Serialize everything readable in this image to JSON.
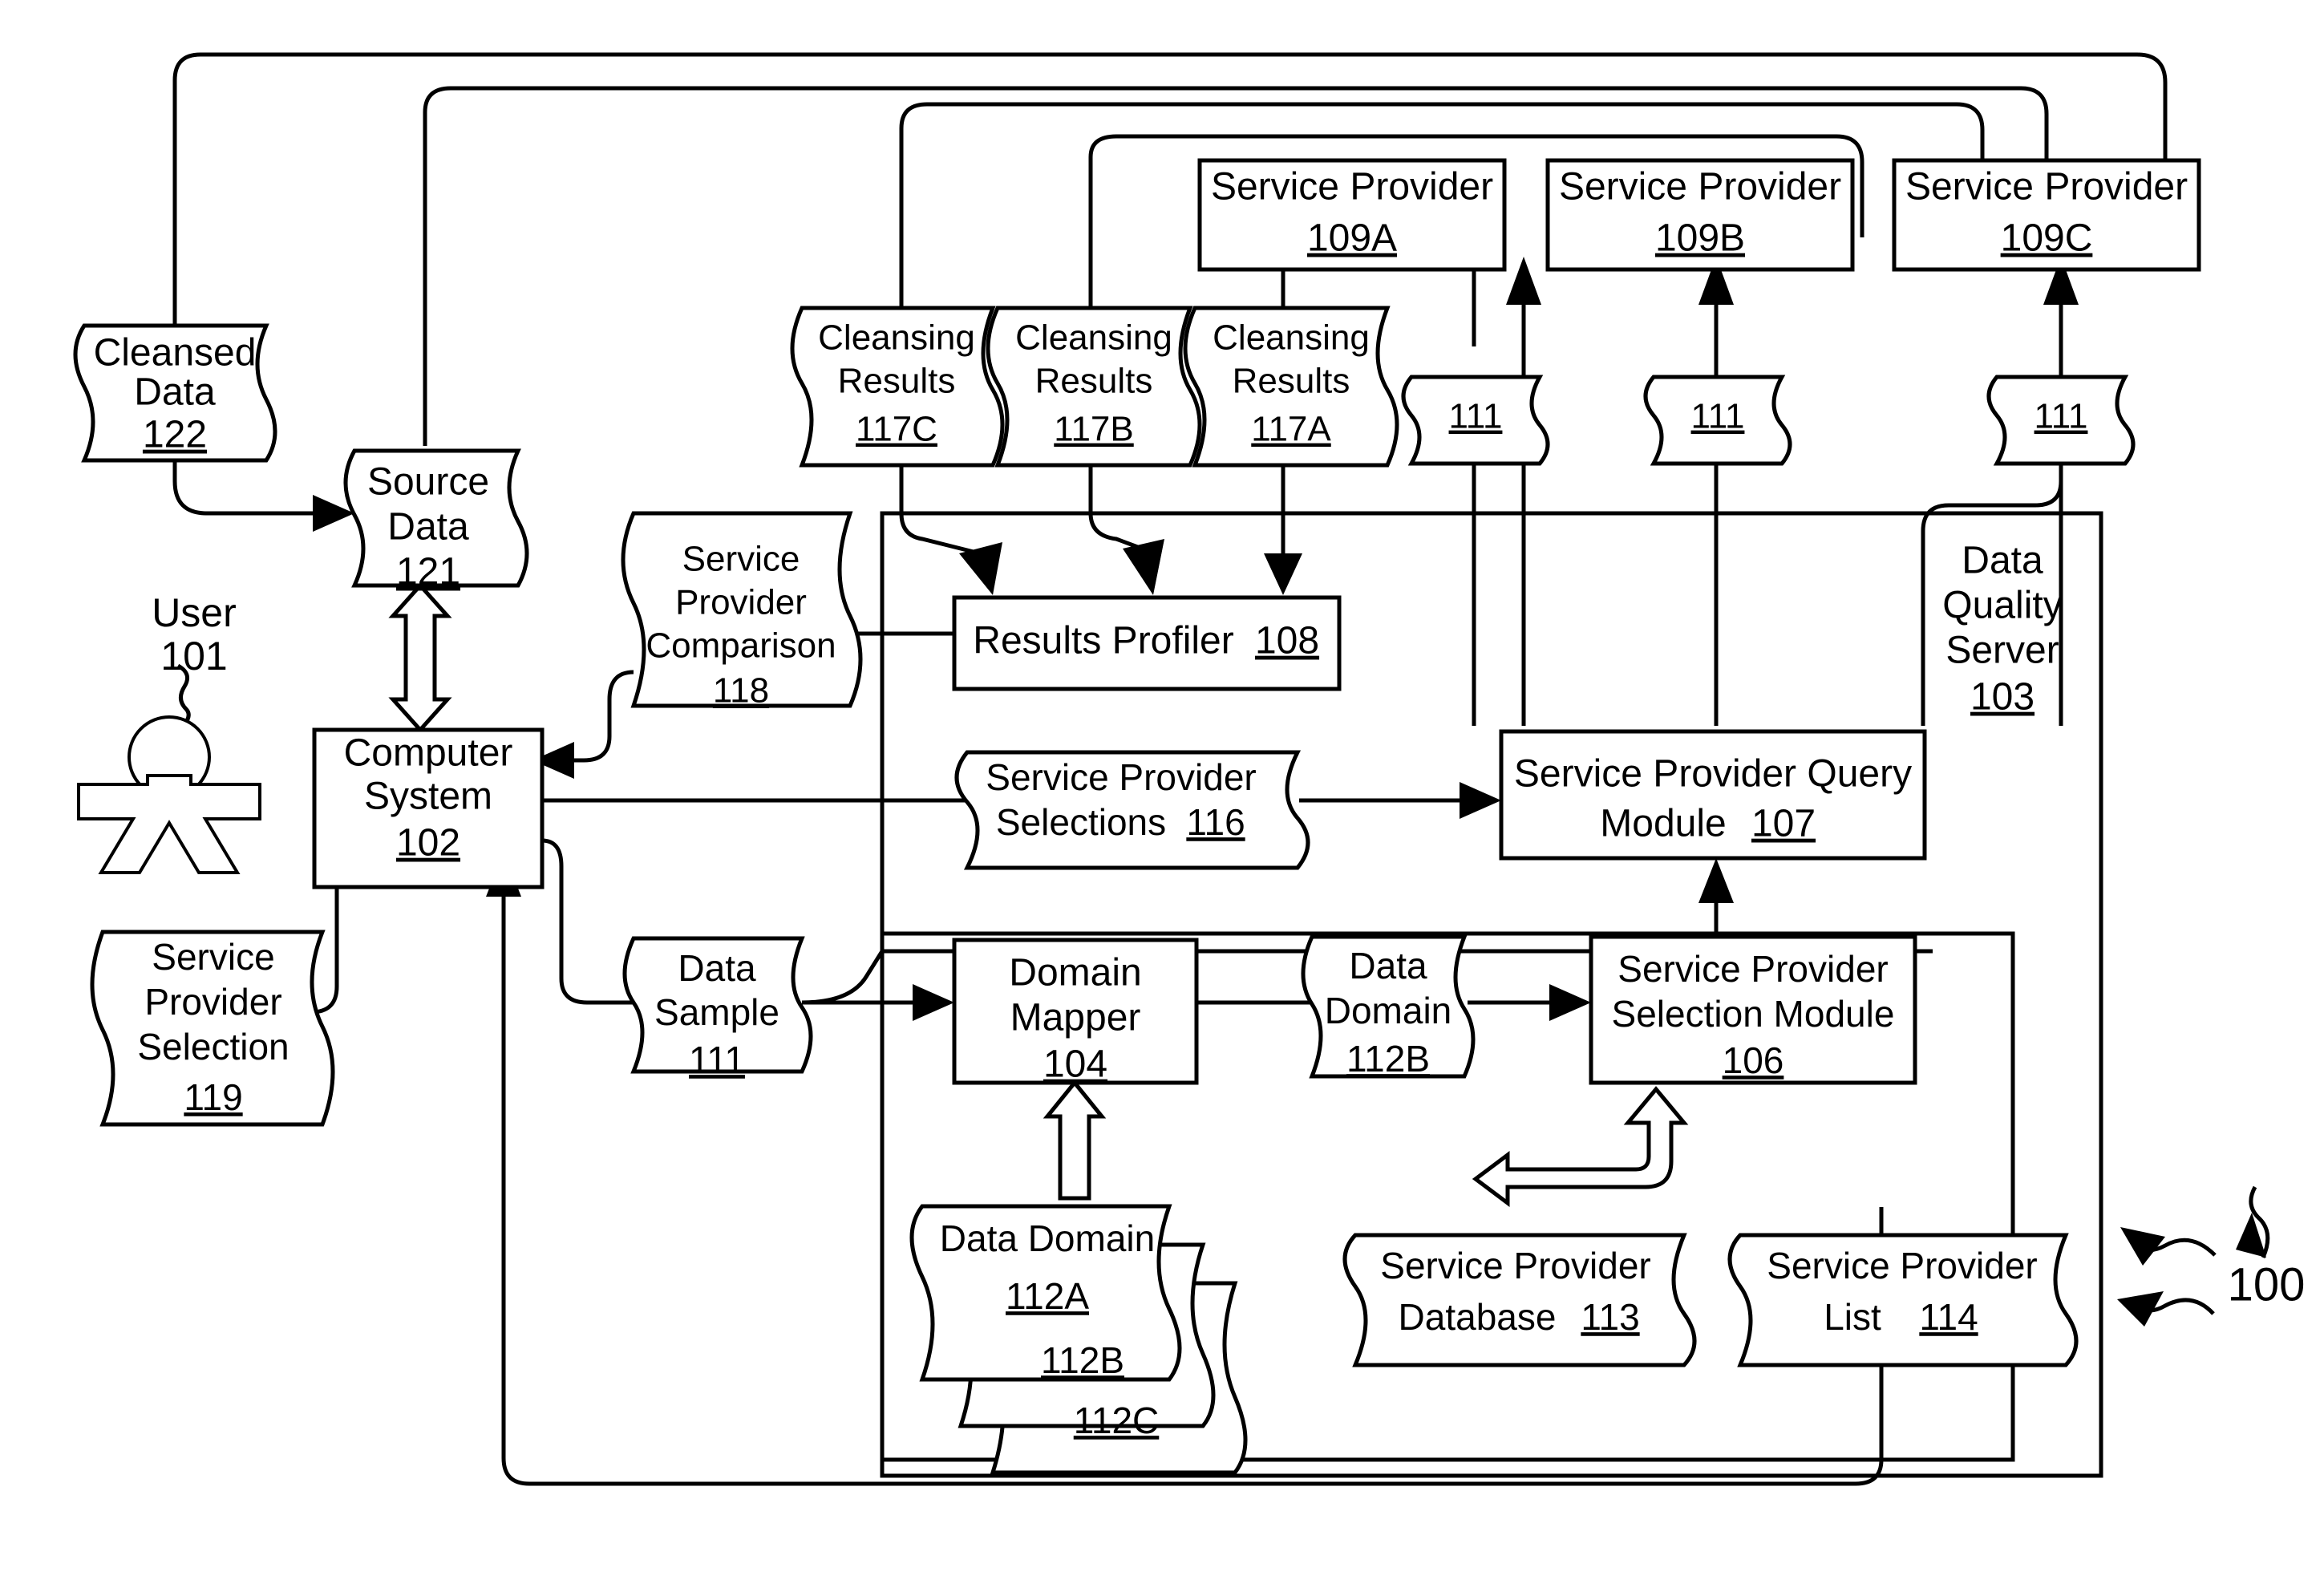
{
  "figure": {
    "reference_numeral": "100",
    "nodes": {
      "cleansed_data": {
        "title": "Cleansed",
        "title2": "Data",
        "ref": "122"
      },
      "source_data": {
        "title": "Source",
        "title2": "Data",
        "ref": "121"
      },
      "user": {
        "title": "User",
        "ref": "101"
      },
      "computer_system": {
        "title": "Computer",
        "title2": "System",
        "ref": "102"
      },
      "service_provider_selection": {
        "title": "Service",
        "title2": "Provider",
        "title3": "Selection",
        "ref": "119"
      },
      "service_provider_comparison": {
        "title": "Service",
        "title2": "Provider",
        "title3": "Comparison",
        "ref": "118"
      },
      "cleansing_results_c": {
        "title": "Cleansing",
        "title2": "Results",
        "ref": "117C"
      },
      "cleansing_results_b": {
        "title": "Cleansing",
        "title2": "Results",
        "ref": "117B"
      },
      "cleansing_results_a": {
        "title": "Cleansing",
        "title2": "Results",
        "ref": "117A"
      },
      "service_provider_a": {
        "title": "Service Provider",
        "ref": "109A"
      },
      "service_provider_b": {
        "title": "Service Provider",
        "ref": "109B"
      },
      "service_provider_c": {
        "title": "Service Provider",
        "ref": "109C"
      },
      "sample_a": {
        "ref": "111"
      },
      "sample_b": {
        "ref": "111"
      },
      "sample_c": {
        "ref": "111"
      },
      "results_profiler": {
        "title": "Results Profiler",
        "ref": "108"
      },
      "data_quality_server": {
        "title": "Data",
        "title2": "Quality",
        "title3": "Server",
        "ref": "103"
      },
      "service_provider_selections": {
        "title": "Service Provider",
        "title2": "Selections",
        "ref": "116"
      },
      "service_provider_query_module": {
        "title": "Service Provider Query",
        "title2": "Module",
        "ref": "107"
      },
      "data_sample": {
        "title": "Data",
        "title2": "Sample",
        "ref": "111"
      },
      "domain_mapper": {
        "title": "Domain",
        "title2": "Mapper",
        "ref": "104"
      },
      "data_domain_112b_mid": {
        "title": "Data",
        "title2": "Domain",
        "ref": "112B"
      },
      "service_provider_selection_module": {
        "title": "Service Provider",
        "title2": "Selection Module",
        "ref": "106"
      },
      "data_domain_stack": {
        "title": "Data Domain",
        "ref": "112A",
        "ref2": "112B",
        "ref3": "112C"
      },
      "service_provider_database": {
        "title": "Service Provider",
        "title2": "Database",
        "ref": "113"
      },
      "service_provider_list": {
        "title": "Service Provider",
        "title2": "List",
        "ref": "114"
      }
    }
  }
}
